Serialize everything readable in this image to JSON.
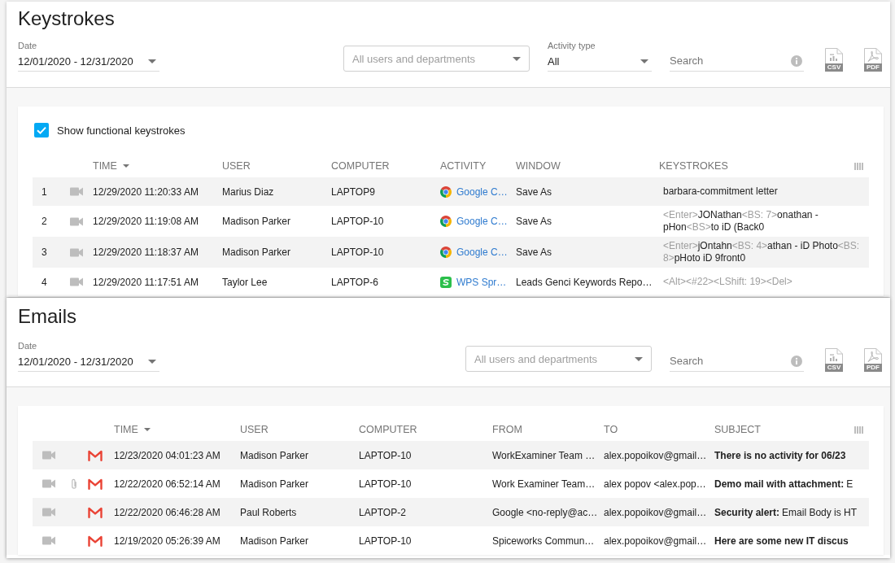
{
  "keystrokes": {
    "title": "Keystrokes",
    "filters": [
      {
        "kind": "date",
        "label": "Date",
        "value": "12/01/2020 - 12/31/2020"
      },
      {
        "kind": "dropdown",
        "placeholder": "All users and departments"
      },
      {
        "kind": "select",
        "label": "Activity type",
        "value": "All"
      },
      {
        "kind": "search",
        "placeholder": "Search"
      }
    ],
    "exports": [
      {
        "kind": "csv",
        "label": "CSV"
      },
      {
        "kind": "pdf",
        "label": "PDF"
      }
    ],
    "option": {
      "label": "Show functional keystrokes",
      "checked": true
    },
    "table": {
      "columns": [
        {
          "label": "TIME",
          "sorted": true
        },
        {
          "label": "USER",
          "sorted": false
        },
        {
          "label": "COMPUTER",
          "sorted": false
        },
        {
          "label": "ACTIVITY",
          "sorted": false
        },
        {
          "label": "WINDOW",
          "sorted": false
        },
        {
          "label": "KEYSTROKES",
          "sorted": false
        }
      ],
      "rows": [
        {
          "number": "1",
          "time": "12/29/2020 11:20:33 AM",
          "user": "Marius Diaz",
          "computer": "LAPTOP9",
          "activity": {
            "kind": "browser",
            "label": "Google C…"
          },
          "window": "Save As",
          "keystrokes": [
            {
              "kind": "text",
              "text": "barbara-commitment letter"
            }
          ]
        },
        {
          "number": "2",
          "time": "12/29/2020 11:19:08 AM",
          "user": "Madison Parker",
          "computer": "LAPTOP-10",
          "activity": {
            "kind": "browser",
            "label": "Google C…"
          },
          "window": "Save As",
          "keystrokes": [
            {
              "kind": "key",
              "text": "<Enter>"
            },
            {
              "kind": "text",
              "text": "JONathan"
            },
            {
              "kind": "key",
              "text": "<BS: 7>"
            },
            {
              "kind": "text",
              "text": "onathan - pHon"
            },
            {
              "kind": "key",
              "text": "<BS>"
            },
            {
              "kind": "text",
              "text": "to iD (Back0"
            }
          ]
        },
        {
          "number": "3",
          "time": "12/29/2020 11:18:37 AM",
          "user": "Madison Parker",
          "computer": "LAPTOP-10",
          "activity": {
            "kind": "browser",
            "label": "Google C…"
          },
          "window": "Save As",
          "keystrokes": [
            {
              "kind": "key",
              "text": "<Enter>"
            },
            {
              "kind": "text",
              "text": "jOntahn"
            },
            {
              "kind": "key",
              "text": "<BS: 4>"
            },
            {
              "kind": "text",
              "text": "athan - iD Photo"
            },
            {
              "kind": "key",
              "text": "<BS: 8>"
            },
            {
              "kind": "text",
              "text": "pHoto iD 9front0"
            }
          ]
        },
        {
          "number": "4",
          "time": "12/29/2020 11:17:51 AM",
          "user": "Taylor Lee",
          "computer": "LAPTOP-6",
          "activity": {
            "kind": "spreadsheet",
            "label": "WPS Spr…"
          },
          "window": "Leads Genci Keywords Repo…",
          "keystrokes": [
            {
              "kind": "key",
              "text": "<Alt><#22><LShift: 19><Del>"
            }
          ]
        }
      ]
    }
  },
  "emails": {
    "title": "Emails",
    "filters": [
      {
        "kind": "date",
        "label": "Date",
        "value": "12/01/2020 - 12/31/2020"
      },
      {
        "kind": "dropdown",
        "placeholder": "All users and departments"
      },
      {
        "kind": "search",
        "placeholder": "Search"
      }
    ],
    "exports": [
      {
        "kind": "csv",
        "label": "CSV"
      },
      {
        "kind": "pdf",
        "label": "PDF"
      }
    ],
    "table": {
      "columns": [
        {
          "label": "TIME",
          "sorted": true
        },
        {
          "label": "USER",
          "sorted": false
        },
        {
          "label": "COMPUTER",
          "sorted": false
        },
        {
          "label": "FROM",
          "sorted": false
        },
        {
          "label": "TO",
          "sorted": false
        },
        {
          "label": "SUBJECT",
          "sorted": false
        }
      ],
      "rows": [
        {
          "attachment": false,
          "time": "12/23/2020 04:01:23 AM",
          "user": "Madison Parker",
          "computer": "LAPTOP-10",
          "from": "WorkExaminer Team …",
          "to": "alex.popoikov@gmail…",
          "subject": "There is no activity for 06/23"
        },
        {
          "attachment": true,
          "time": "12/22/2020 06:52:14 AM",
          "user": "Madison Parker",
          "computer": "LAPTOP-10",
          "from": "Work Examiner Team…",
          "to": "alex popov <alex.pop…",
          "subject": "Demo mail with attachment:",
          "preview": "E"
        },
        {
          "attachment": false,
          "time": "12/22/2020 06:46:28 AM",
          "user": "Paul Roberts",
          "computer": "LAPTOP-2",
          "from": "Google <no-reply@ac…",
          "to": "alex.popoikov@gmail…",
          "subject": "Security alert:",
          "preview": "Email Body is HT"
        },
        {
          "attachment": false,
          "time": "12/19/2020 05:26:39 AM",
          "user": "Madison Parker",
          "computer": "LAPTOP-10",
          "from": "Spiceworks Commun…",
          "to": "alex.popoikov@gmail…",
          "subject": "Here are some new IT discus"
        }
      ]
    }
  }
}
